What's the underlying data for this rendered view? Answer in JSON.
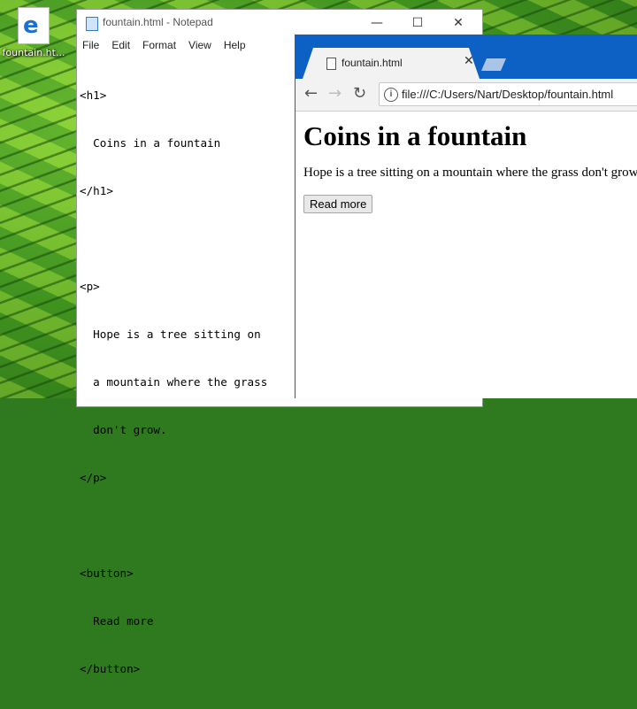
{
  "desktop": {
    "icon_label": "fountain.ht..."
  },
  "notepad": {
    "title": "fountain.html - Notepad",
    "menu": [
      "File",
      "Edit",
      "Format",
      "View",
      "Help"
    ],
    "lines": [
      "<h1>",
      "  Coins in a fountain",
      "</h1>",
      "",
      "<p>",
      "  Hope is a tree sitting on",
      "  a mountain where the grass",
      "  don't grow.",
      "</p>",
      "",
      "<button>",
      "  Read more",
      "</button>"
    ]
  },
  "browser": {
    "tab_title": "fountain.html",
    "url": "file:///C:/Users/Nart/Desktop/fountain.html",
    "page": {
      "heading": "Coins in a fountain",
      "paragraph": "Hope is a tree sitting on a mountain where the grass don't grow.",
      "button_label": "Read more"
    }
  }
}
